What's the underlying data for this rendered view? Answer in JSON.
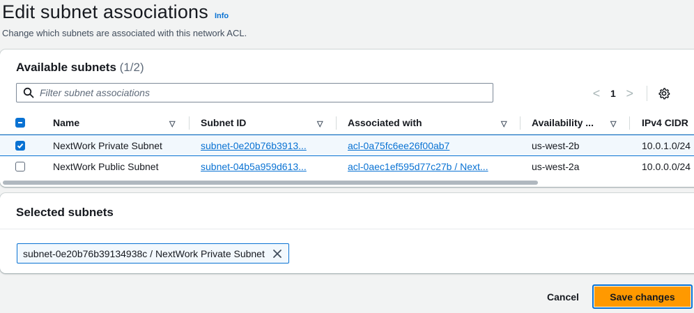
{
  "page": {
    "title": "Edit subnet associations",
    "info_label": "Info",
    "description": "Change which subnets are associated with this network ACL."
  },
  "available": {
    "title": "Available subnets",
    "count": "(1/2)",
    "filter_placeholder": "Filter subnet associations",
    "pagination": {
      "current_page": "1",
      "prev": "<",
      "next": ">"
    },
    "columns": [
      "Name",
      "Subnet ID",
      "Associated with",
      "Availability ...",
      "IPv4 CIDR"
    ],
    "rows": [
      {
        "selected": true,
        "name": "NextWork Private Subnet",
        "subnet_id": "subnet-0e20b76b3913...",
        "associated_with": "acl-0a75fc6ee26f00ab7",
        "availability_zone": "us-west-2b",
        "ipv4_cidr": "10.0.1.0/24"
      },
      {
        "selected": false,
        "name": "NextWork Public Subnet",
        "subnet_id": "subnet-04b5a959d613...",
        "associated_with": "acl-0aec1ef595d77c27b / Next...",
        "availability_zone": "us-west-2a",
        "ipv4_cidr": "10.0.0.0/24"
      }
    ],
    "scroll_fraction": 0.77
  },
  "selected": {
    "title": "Selected subnets",
    "tokens": [
      "subnet-0e20b76b39134938c / NextWork Private Subnet"
    ]
  },
  "actions": {
    "cancel_label": "Cancel",
    "save_label": "Save changes"
  },
  "colors": {
    "primary_blue": "#0972d3",
    "save_orange": "#ff9900",
    "selected_row_bg": "#f2f8fd",
    "page_bg": "#f2f3f3"
  },
  "icons": [
    "search-icon",
    "settings-gear-icon",
    "chevron-left-icon",
    "chevron-right-icon",
    "sort-icon",
    "close-icon",
    "checkbox-checked-icon",
    "checkbox-indeterminate-icon"
  ]
}
